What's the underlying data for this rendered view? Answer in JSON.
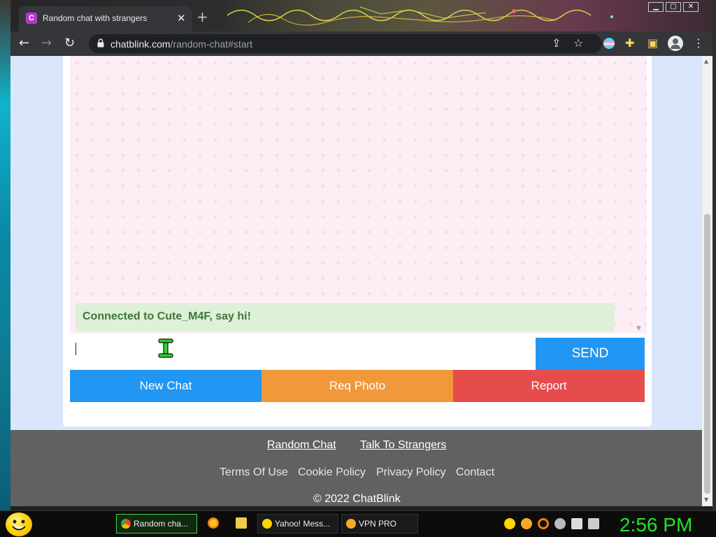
{
  "browser": {
    "tab_title": "Random chat with strangers",
    "tab_favicon_letter": "C",
    "url_domain": "chatblink.com",
    "url_path": "/random-chat#start"
  },
  "chat": {
    "system_message": "Connected to Cute_M4F, say hi!",
    "input_value": "",
    "send_label": "SEND",
    "new_chat_label": "New Chat",
    "req_photo_label": "Req Photo",
    "report_label": "Report"
  },
  "footer": {
    "link_random_chat": "Random Chat",
    "link_talk_to_strangers": "Talk To Strangers",
    "terms": "Terms Of Use",
    "cookie": "Cookie Policy",
    "privacy": "Privacy Policy",
    "contact": "Contact",
    "copyright": "© 2022 ChatBlink"
  },
  "taskbar": {
    "tasks": [
      {
        "label": "Random cha..."
      },
      {
        "label": "Yahoo! Mess..."
      },
      {
        "label": "VPN PRO"
      }
    ],
    "clock": "2:56 PM"
  },
  "colors": {
    "send": "#2196f3",
    "new_chat": "#2196f3",
    "req_photo": "#f0983a",
    "report": "#e74c4c",
    "system_msg_bg": "#dff0d8",
    "system_msg_text": "#3c763d",
    "footer_bg": "#616161",
    "clock": "#22e322"
  }
}
